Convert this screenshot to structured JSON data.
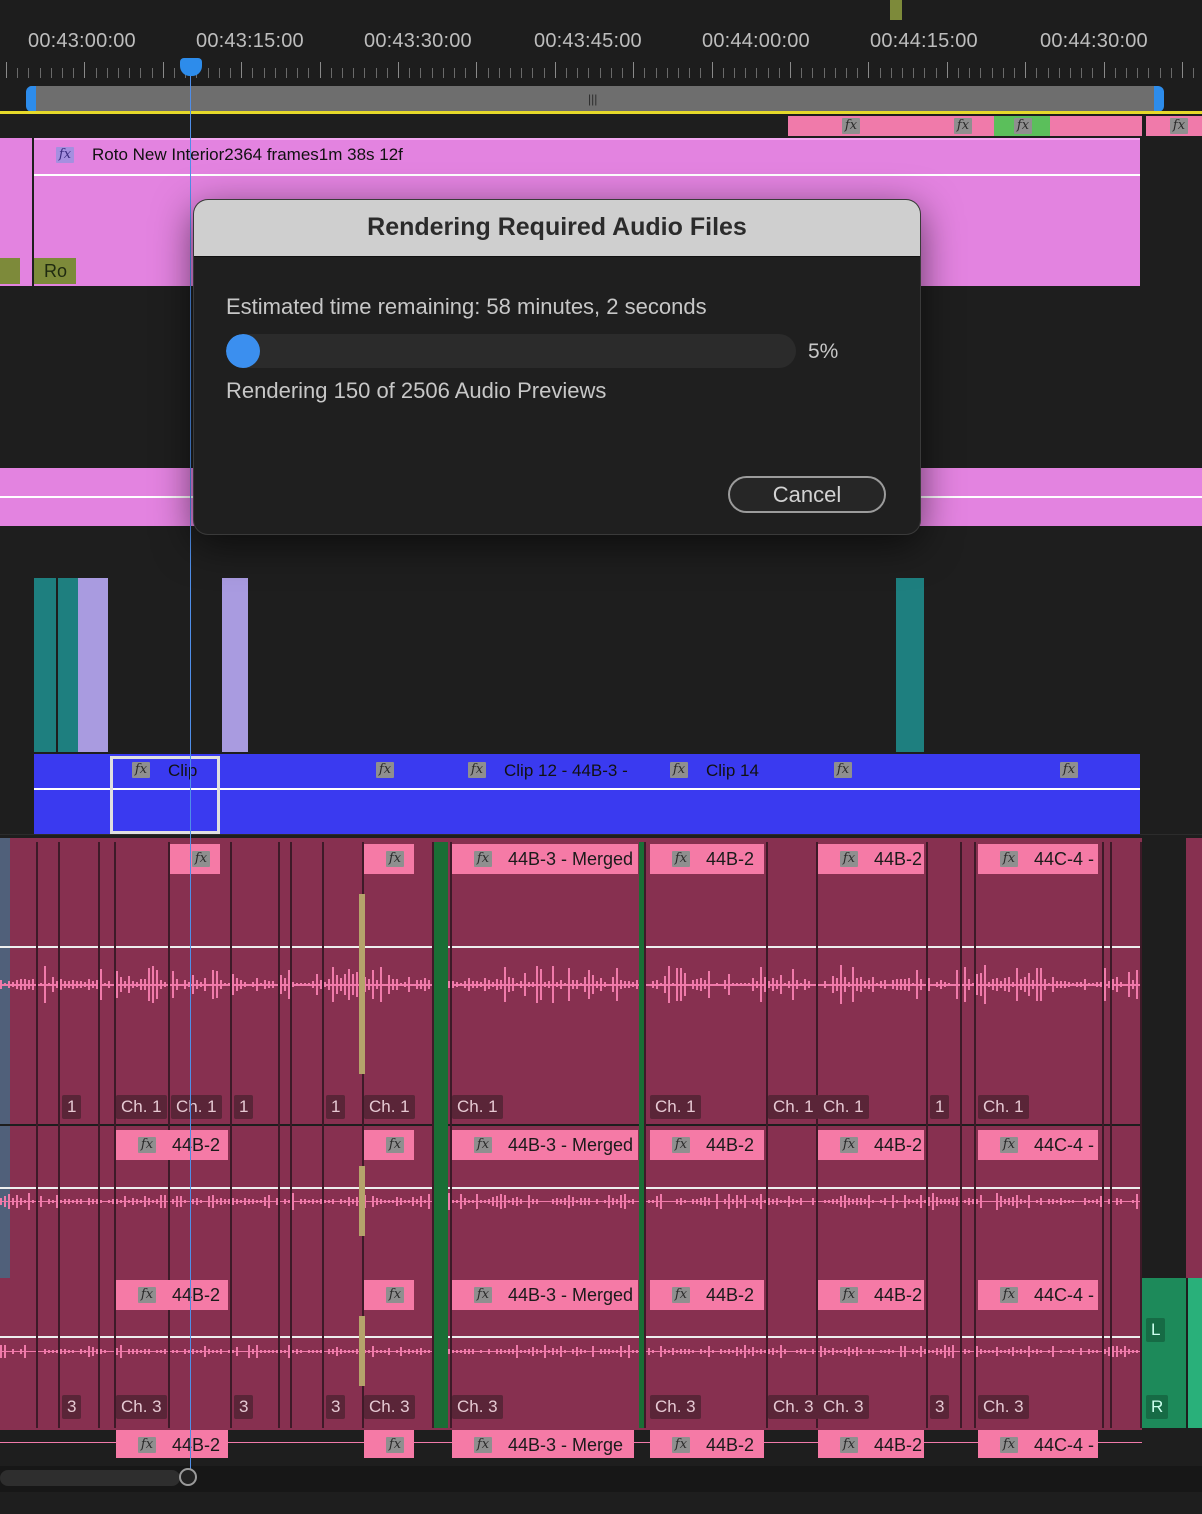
{
  "timecodes": [
    "00:43:00:00",
    "00:43:15:00",
    "00:43:30:00",
    "00:43:45:00",
    "00:44:00:00",
    "00:44:15:00",
    "00:44:30:00"
  ],
  "icons": {
    "fx": "fx-icon",
    "workarea_grip": "grip-icon"
  },
  "video_track": {
    "clip_name": "Roto New Interior",
    "clip_frames": "2364 frames",
    "clip_duration": "1m 38s 12f",
    "small_label": "Ro"
  },
  "adjustment_track": {
    "clips": [
      {
        "label": "Clip"
      },
      {
        "label": "Clip 12 - 44B-3 -"
      },
      {
        "label": "Clip 14"
      }
    ]
  },
  "audio_labels": {
    "merged": "44B-3 - Merged",
    "merged_cut": "44B-3 - Merge",
    "b2": "44B-2",
    "c4": "44C-4 -",
    "ch1": "Ch. 1",
    "ch3": "Ch. 3",
    "n1": "1",
    "n3": "3",
    "L": "L",
    "R": "R"
  },
  "dialog": {
    "title": "Rendering Required Audio Files",
    "estimated": "Estimated time remaining: 58 minutes, 2 seconds",
    "progress_percent": 5,
    "progress_label": "5%",
    "status": "Rendering 150 of 2506 Audio Previews",
    "cancel_label": "Cancel"
  },
  "colors": {
    "video_clip": "#e383e0",
    "audio_clip": "#873050",
    "audio_label": "#f57aa6",
    "adjustment": "#3a3af0",
    "accent": "#3b8fef",
    "teal": "#1e7f7f",
    "lavender": "#a99be0",
    "green_audio": "#1d8a5a",
    "inout_line": "#e6d92a"
  }
}
